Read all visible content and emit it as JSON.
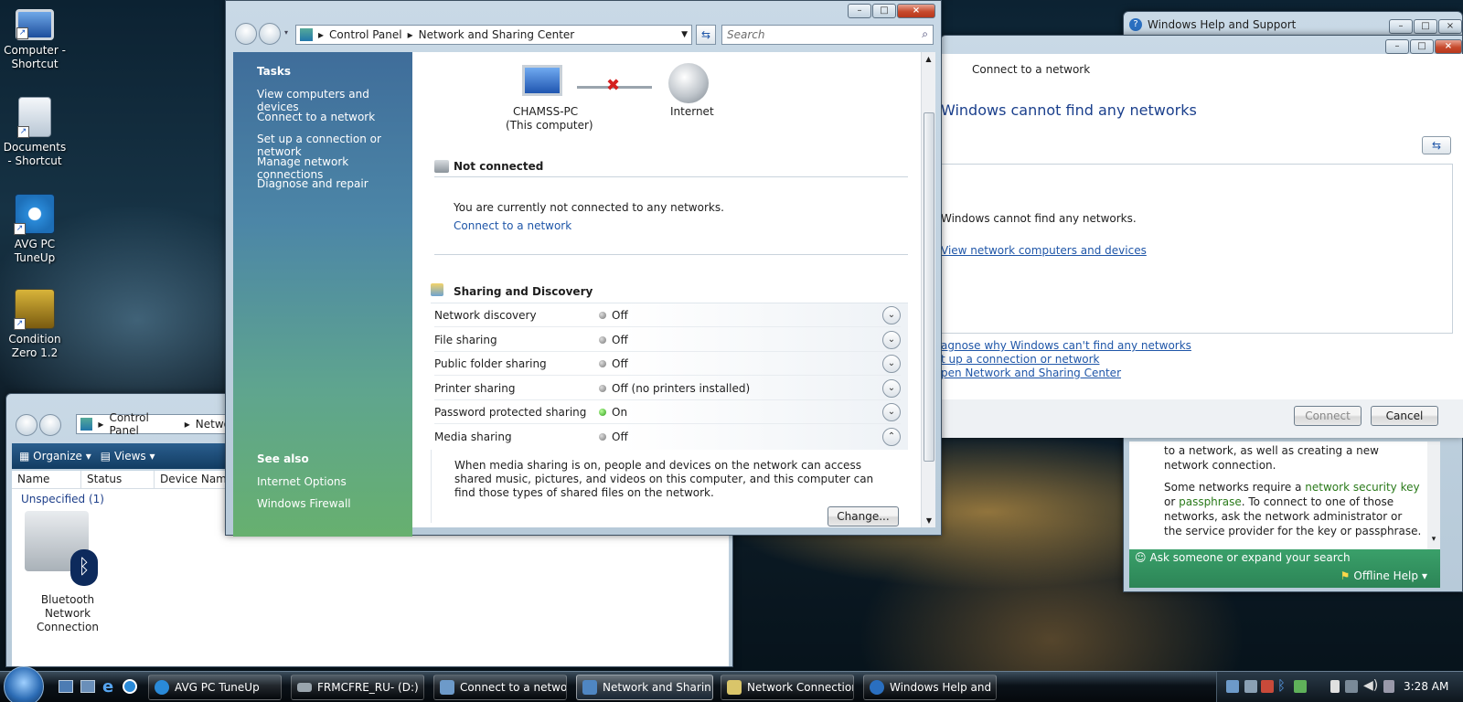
{
  "desktop": {
    "icons": [
      {
        "label": "Computer - Shortcut"
      },
      {
        "label": "Documents - Shortcut"
      },
      {
        "label": "AVG PC TuneUp"
      },
      {
        "label": "Condition Zero 1.2"
      }
    ]
  },
  "nsc": {
    "breadcrumb": [
      "Control Panel",
      "Network and Sharing Center"
    ],
    "search_placeholder": "Search",
    "tasks_title": "Tasks",
    "tasks": [
      "View computers and devices",
      "Connect to a network",
      "Set up a connection or network",
      "Manage network connections",
      "Diagnose and repair"
    ],
    "see_also_title": "See also",
    "see_also": [
      "Internet Options",
      "Windows Firewall"
    ],
    "map": {
      "computer_name": "CHAMSS-PC",
      "computer_sub": "(This computer)",
      "internet": "Internet"
    },
    "status_title": "Not connected",
    "status_text": "You are currently not connected to any networks.",
    "status_link": "Connect to a network",
    "sharing_title": "Sharing and Discovery",
    "sharing_rows": [
      {
        "label": "Network discovery",
        "value": "Off",
        "state": "off"
      },
      {
        "label": "File sharing",
        "value": "Off",
        "state": "off"
      },
      {
        "label": "Public folder sharing",
        "value": "Off",
        "state": "off"
      },
      {
        "label": "Printer sharing",
        "value": "Off (no printers installed)",
        "state": "off"
      },
      {
        "label": "Password protected sharing",
        "value": "On",
        "state": "on"
      },
      {
        "label": "Media sharing",
        "value": "Off",
        "state": "off"
      }
    ],
    "media_desc": "When media sharing is on, people and devices on the network can access shared music, pictures, and videos on this computer, and this computer can find those types of shared files on the network.",
    "change_button": "Change..."
  },
  "netconn": {
    "breadcrumb": [
      "Control Panel",
      "Netwo"
    ],
    "organize": "Organize",
    "views": "Views",
    "columns": [
      "Name",
      "Status",
      "Device Name"
    ],
    "group": "Unspecified (1)",
    "item_label": "Bluetooth Network Connection"
  },
  "help": {
    "title": "Windows Help and Support",
    "text1": "to a network, as well as creating a new network connection.",
    "text2_a": "Some networks require a ",
    "text2_link1": "network security key",
    "text2_b": " or ",
    "text2_link2": "passphrase",
    "text2_c": ". To connect to one of those networks, ask the network administrator or the service provider for the key or passphrase.",
    "ask": "Ask someone or expand your search",
    "offline": "Offline Help"
  },
  "connect": {
    "title": "Connect to a network",
    "heading": "Windows cannot find any networks",
    "message": "Windows cannot find any networks.",
    "view_link": "View network computers and devices",
    "links": [
      "agnose why Windows can't find any networks",
      "t up a connection or network",
      "pen Network and Sharing Center"
    ],
    "connect_button": "Connect",
    "cancel_button": "Cancel"
  },
  "taskbar": {
    "items": [
      "AVG PC TuneUp",
      "FRMCFRE_RU- (D:)",
      "Connect to a network",
      "Network and Sharin...",
      "Network Connections",
      "Windows Help and ..."
    ],
    "clock": "3:28 AM"
  }
}
